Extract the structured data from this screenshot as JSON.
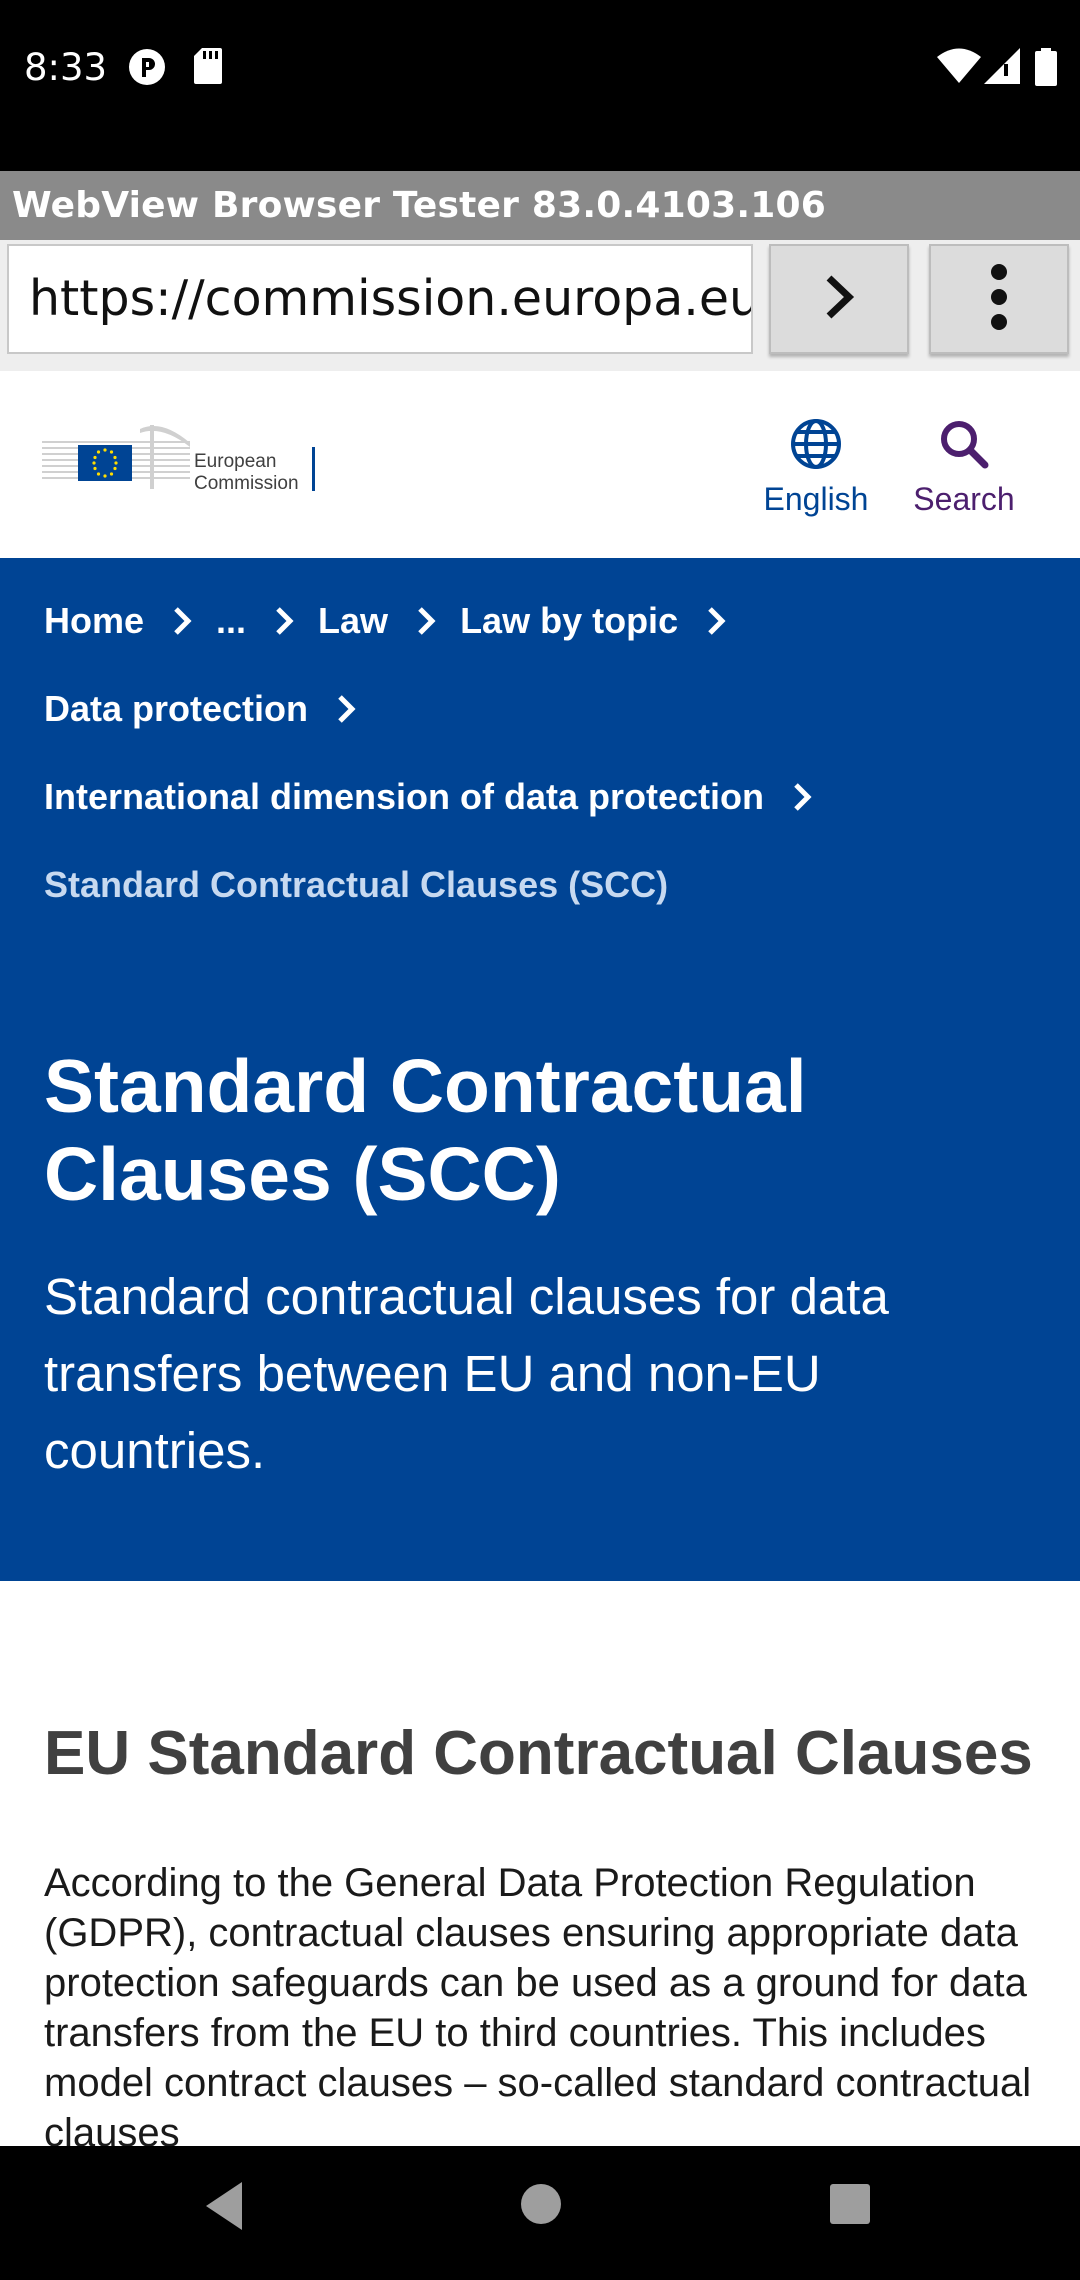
{
  "status_bar": {
    "time": "8:33",
    "icons": [
      "p-circle-icon",
      "sd-card-icon",
      "wifi-icon",
      "signal-icon",
      "battery-icon"
    ]
  },
  "app": {
    "title": "WebView Browser Tester 83.0.4103.106"
  },
  "url_bar": {
    "value": "https://commission.europa.eu/l",
    "go_icon": "chevron-right-icon",
    "menu_icon": "more-vert-icon"
  },
  "site_header": {
    "logo_line1": "European",
    "logo_line2": "Commission",
    "language_label": "English",
    "search_label": "Search"
  },
  "breadcrumb": {
    "items": [
      "Home",
      "...",
      "Law",
      "Law by topic",
      "Data protection",
      "International dimension of data protection"
    ],
    "current": "Standard Contractual Clauses (SCC)"
  },
  "hero": {
    "title": "Standard Contractual Clauses (SCC)",
    "subtitle": "Standard contractual clauses for data transfers between EU and non-EU  countries."
  },
  "content": {
    "heading": "EU Standard Contractual Clauses",
    "paragraph": "According to the General Data Protection Regulation (GDPR), contractual clauses ensuring appropriate data protection safeguards can be used as a ground for data transfers from the EU to third countries. This includes model contract clauses – so-called standard contractual clauses"
  },
  "colors": {
    "ec_blue": "#004494",
    "search_purple": "#4c1f6e",
    "breadcrumb_current": "#c7d9f0",
    "heading_gray": "#404040"
  },
  "nav_bar": {
    "icons": [
      "back-icon",
      "home-icon",
      "recents-icon"
    ]
  }
}
